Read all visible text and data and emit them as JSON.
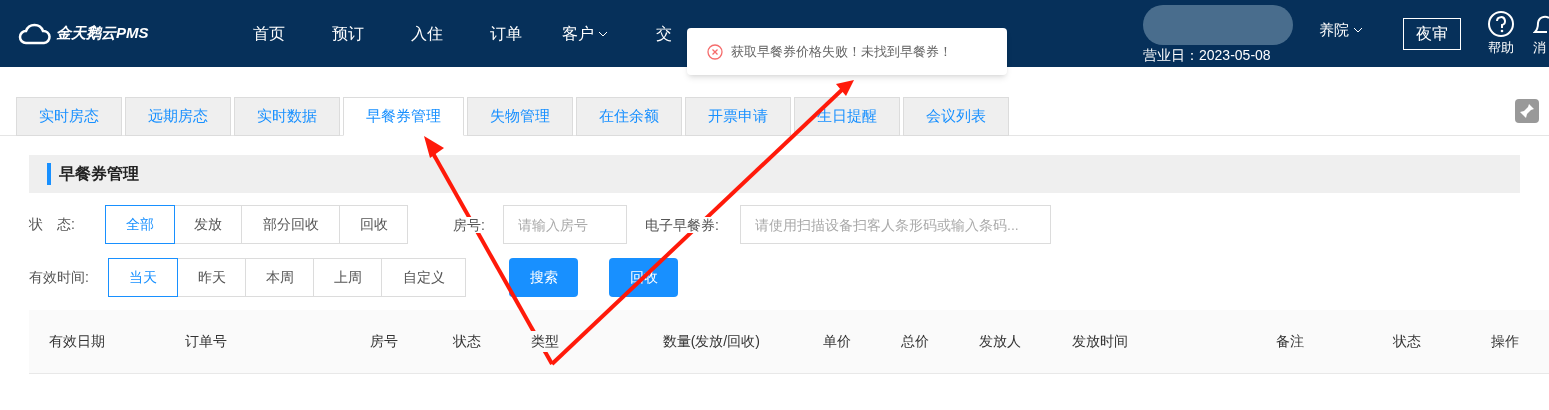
{
  "header": {
    "brand": "金天鹅云PMS",
    "nav": [
      {
        "label": "首页",
        "dropdown": false
      },
      {
        "label": "预订",
        "dropdown": false
      },
      {
        "label": "入住",
        "dropdown": false
      },
      {
        "label": "订单",
        "dropdown": false
      },
      {
        "label": "客户",
        "dropdown": true
      },
      {
        "label": "交",
        "dropdown": false
      }
    ],
    "hotel": "养院",
    "business_day": "营业日：2023-05-08",
    "night_audit": "夜审",
    "help": "帮助",
    "messages": "消"
  },
  "toast": {
    "kind": "error",
    "text": "获取早餐券价格失败！未找到早餐券！"
  },
  "tabs": [
    {
      "label": "实时房态",
      "selected": false
    },
    {
      "label": "远期房态",
      "selected": false
    },
    {
      "label": "实时数据",
      "selected": false
    },
    {
      "label": "早餐券管理",
      "selected": true
    },
    {
      "label": "失物管理",
      "selected": false
    },
    {
      "label": "在住余额",
      "selected": false
    },
    {
      "label": "开票申请",
      "selected": false
    },
    {
      "label": "生日提醒",
      "selected": false
    },
    {
      "label": "会议列表",
      "selected": false
    }
  ],
  "section_title": "早餐券管理",
  "filters": {
    "status_label": "状　态:",
    "status_options": [
      {
        "label": "全部",
        "selected": true
      },
      {
        "label": "发放",
        "selected": false
      },
      {
        "label": "部分回收",
        "selected": false
      },
      {
        "label": "回收",
        "selected": false
      }
    ],
    "room_label": "房号:",
    "room_placeholder": "请输入房号",
    "voucher_label": "电子早餐券:",
    "voucher_placeholder": "请使用扫描设备扫客人条形码或输入条码...",
    "time_label": "有效时间:",
    "time_options": [
      {
        "label": "当天",
        "selected": true
      },
      {
        "label": "昨天",
        "selected": false
      },
      {
        "label": "本周",
        "selected": false
      },
      {
        "label": "上周",
        "selected": false
      },
      {
        "label": "自定义",
        "selected": false
      }
    ],
    "buttons": [
      "搜索",
      "回收"
    ]
  },
  "table": {
    "columns": [
      "有效日期",
      "订单号",
      "房号",
      "状态",
      "类型",
      "数量(发放/回收)",
      "单价",
      "总价",
      "发放人",
      "发放时间",
      "备注",
      "状态",
      "操作"
    ]
  }
}
